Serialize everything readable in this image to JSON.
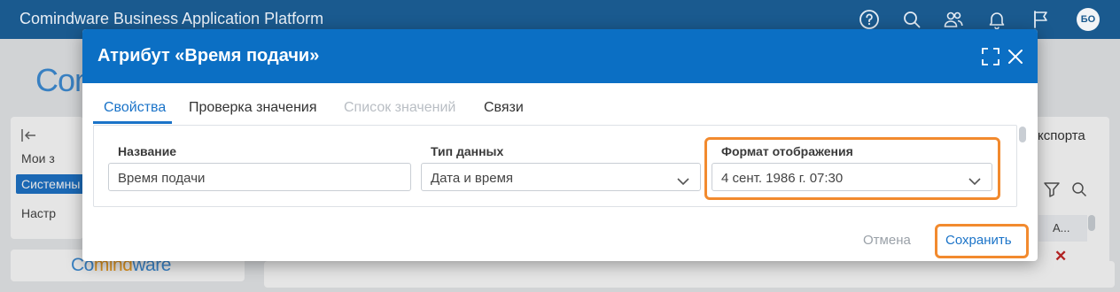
{
  "app": {
    "title": "Comindware Business Application Platform",
    "user_initials": "БО"
  },
  "topbar_icons": [
    "help-icon",
    "search-icon",
    "users-icon",
    "bell-icon",
    "flag-icon"
  ],
  "background": {
    "logo_text": "Com",
    "nav_items": [
      "Мои з",
      "Системны",
      "Настр"
    ],
    "footer_logo_prefix": "Co",
    "footer_logo_mid": "mind",
    "footer_logo_suffix": "ware",
    "export_label": "кспорта",
    "column_header": "А..."
  },
  "dialog": {
    "title": "Атрибут «Время подачи»",
    "tabs": [
      {
        "label": "Свойства",
        "state": "active"
      },
      {
        "label": "Проверка значения",
        "state": "normal"
      },
      {
        "label": "Список значений",
        "state": "disabled"
      },
      {
        "label": "Связи",
        "state": "normal"
      }
    ],
    "fields": {
      "name": {
        "label": "Название",
        "value": "Время подачи"
      },
      "data_type": {
        "label": "Тип данных",
        "value": "Дата и время"
      },
      "display_format": {
        "label": "Формат отображения",
        "value": "4 сент. 1986 г. 07:30"
      }
    },
    "cancel_label": "Отмена",
    "save_label": "Сохранить"
  },
  "colors": {
    "header": "#1a5a8f",
    "dialog_header": "#0b6fc4",
    "accent": "#1a73c8",
    "highlight": "#f28a2e"
  }
}
